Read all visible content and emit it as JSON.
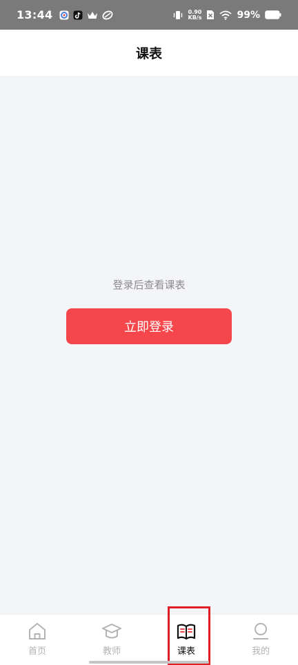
{
  "status_bar": {
    "time": "13:44",
    "net_speed_value": "0.90",
    "net_speed_unit": "KB/s",
    "battery": "99%"
  },
  "header": {
    "title": "课表"
  },
  "main": {
    "login_hint": "登录后查看课表",
    "login_button_label": "立即登录"
  },
  "tab_bar": {
    "tabs": [
      {
        "label": "首页",
        "icon": "home-icon",
        "active": false
      },
      {
        "label": "教师",
        "icon": "graduation-cap-icon",
        "active": false
      },
      {
        "label": "课表",
        "icon": "book-icon",
        "active": true
      },
      {
        "label": "我的",
        "icon": "profile-icon",
        "active": false
      }
    ]
  },
  "colors": {
    "accent": "#f5464b",
    "highlight": "#e01c24",
    "status_bar_bg": "#7a7a7a",
    "page_bg": "#f4f5f9"
  }
}
